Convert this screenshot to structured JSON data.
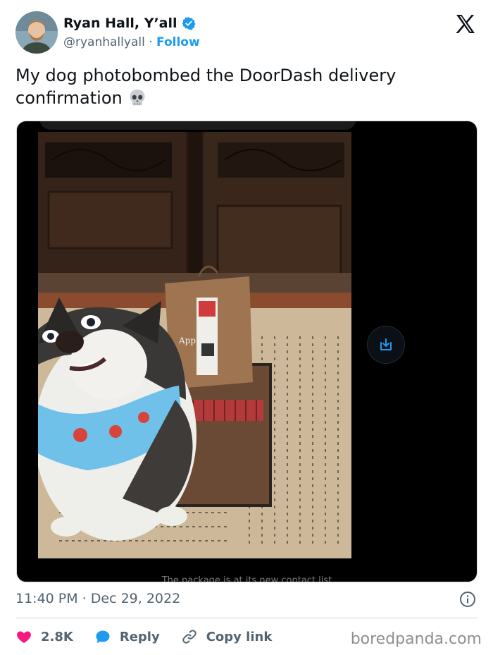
{
  "author": {
    "name": "Ryan Hall, Y’all",
    "handle": "@ryanhallyall",
    "separator": "·",
    "follow_label": "Follow",
    "verified": true
  },
  "tweet": {
    "text": "My dog photobombed the DoorDash delivery confirmation",
    "emoji": "skull-emoji"
  },
  "media": {
    "bag_text": "Appl ees eatery",
    "bottom_cut_text": "The package is at its new contact list"
  },
  "timestamp": "11:40 PM · Dec 29, 2022",
  "actions": {
    "likes": "2.8K",
    "reply_label": "Reply",
    "copy_label": "Copy link"
  },
  "watermark": "boredpanda.com",
  "colors": {
    "accent": "#1d9bf0",
    "like": "#f91880",
    "text": "#0f1419",
    "muted": "#536471"
  }
}
